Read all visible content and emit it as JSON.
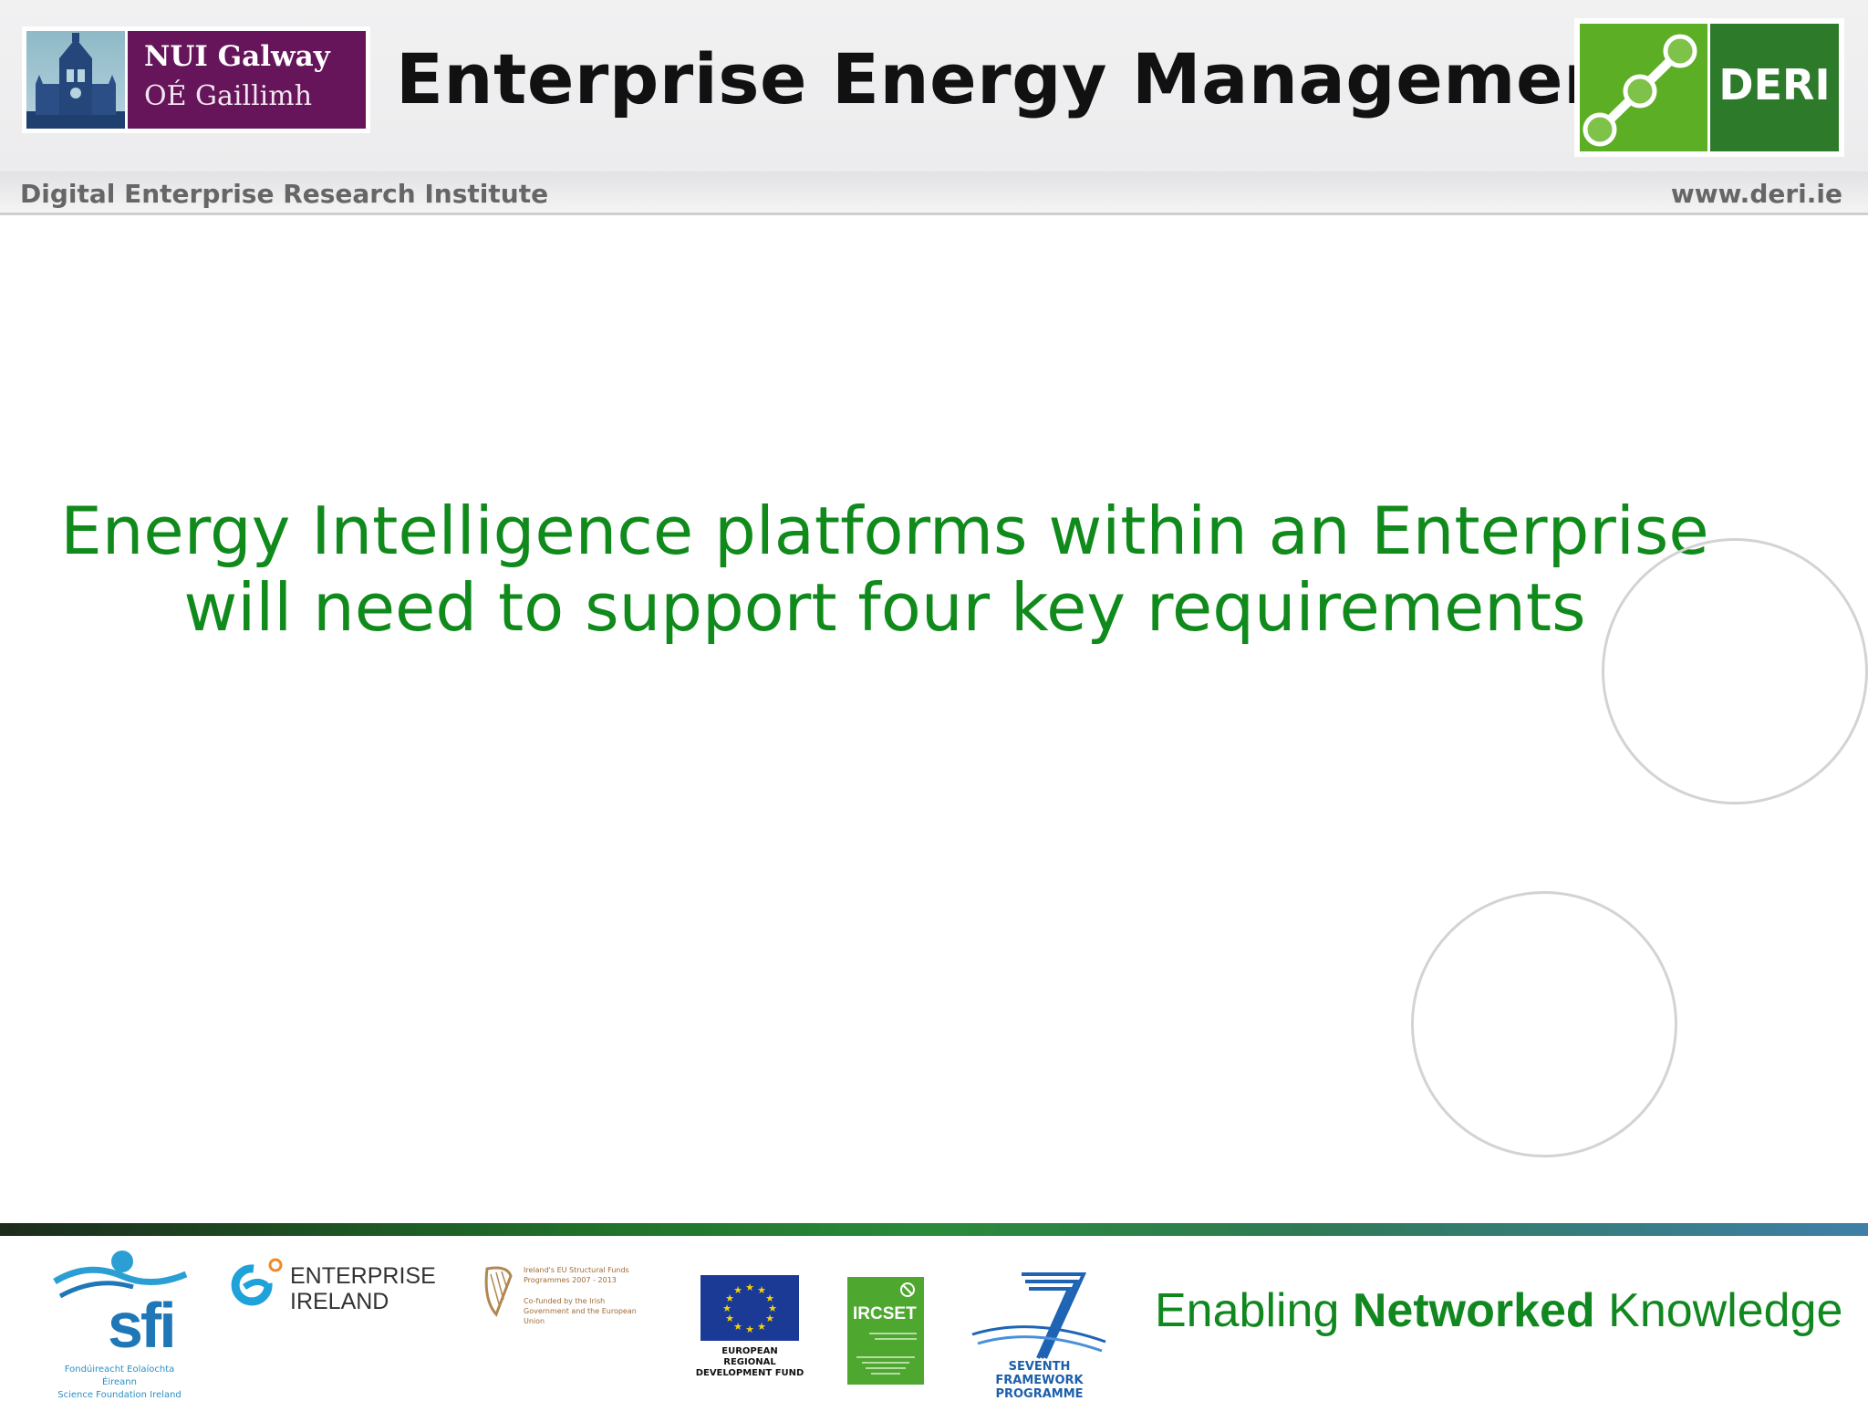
{
  "header": {
    "nui_logo": {
      "line1": "NUI Galway",
      "line2": "OÉ Gaillimh"
    },
    "title": "Enterprise Energy Management",
    "deri_logo": {
      "text": "DERI"
    },
    "institute": "Digital Enterprise Research Institute",
    "website": "www.deri.ie"
  },
  "main": {
    "statement": "Energy Intelligence platforms within an Enterprise will need to support four key requirements"
  },
  "footer": {
    "tagline": {
      "part1": "Enabling ",
      "bold": "Networked",
      "part2": " Knowledge"
    },
    "logos": {
      "sfi": {
        "letters": "sfi",
        "caption_line1": "Fondúireacht Eolaíochta Éireann",
        "caption_line2": "Science Foundation Ireland"
      },
      "enterprise_ireland": {
        "text": "ENTERPRISE\nIRELAND"
      },
      "structural_funds": {
        "text1": "Ireland's EU Structural Funds Programmes 2007 - 2013",
        "text2": "Co-funded by the Irish Government and the European Union"
      },
      "erdf": {
        "caption_line1": "EUROPEAN REGIONAL",
        "caption_line2": "DEVELOPMENT FUND"
      },
      "ircset": {
        "name": "IRCSET"
      },
      "fp7": {
        "caption_line1": "SEVENTH FRAMEWORK",
        "caption_line2": "PROGRAMME"
      }
    }
  },
  "colors": {
    "statement_green": "#0f8a1b",
    "nui_purple": "#66155b",
    "deri_light_green": "#5cae25",
    "deri_dark_green": "#2d7a2a"
  }
}
